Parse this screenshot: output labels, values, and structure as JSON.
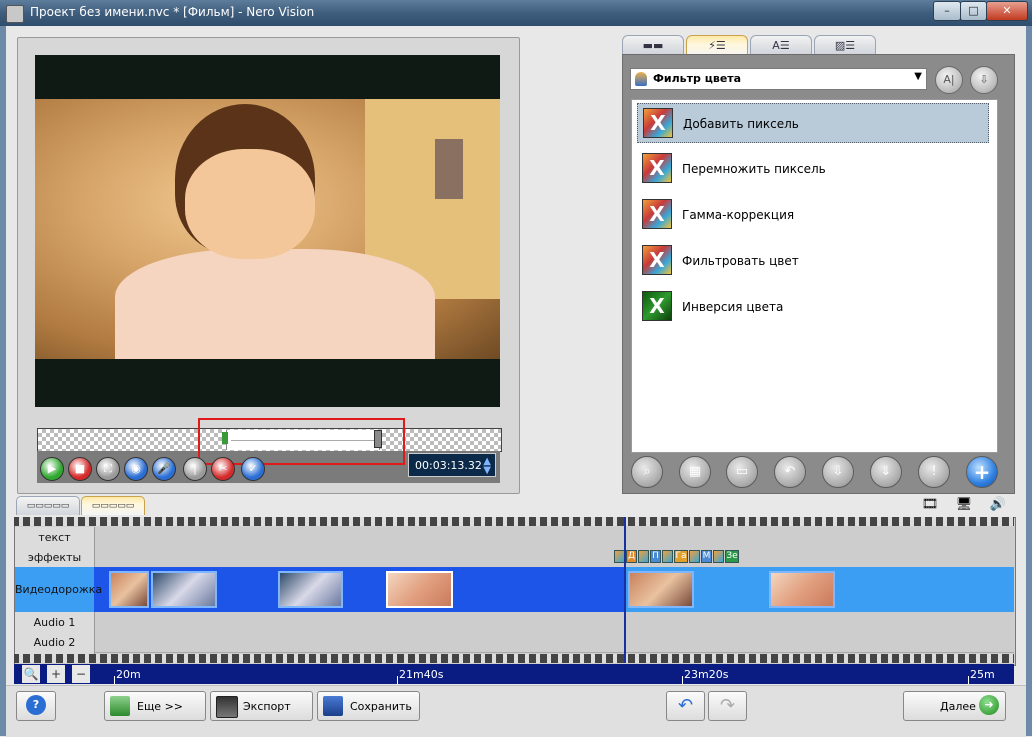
{
  "window": {
    "title": "Проект без имени.nvc * [Фильм] - Nero Vision",
    "min_glyph": "–",
    "max_glyph": "□",
    "close_glyph": "✕"
  },
  "preview": {
    "timecode": "00:03:13.32",
    "spin_up": "▲",
    "spin_down": "▼",
    "controls": [
      {
        "icon": "play-icon",
        "glyph": "▶",
        "color": "#2fa82f"
      },
      {
        "icon": "stop-icon",
        "glyph": "■",
        "color": "#d42a2a"
      },
      {
        "icon": "fullscreen-icon",
        "glyph": "⛶",
        "color": "#9a9a9a"
      },
      {
        "icon": "snapshot-icon",
        "glyph": "◉",
        "color": "#2a6ed4"
      },
      {
        "icon": "mic-icon",
        "glyph": "🎤",
        "color": "#2a6ed4"
      },
      {
        "icon": "split-icon",
        "glyph": "|",
        "color": "#9a9a9a"
      },
      {
        "icon": "cut-icon",
        "glyph": "✂",
        "color": "#d42a2a"
      },
      {
        "icon": "apply-icon",
        "glyph": "✓",
        "color": "#2a6ed4"
      }
    ]
  },
  "right_panel": {
    "tabs": [
      {
        "icon": "video-tab-icon",
        "glyph": "▬▬"
      },
      {
        "icon": "effects-tab-icon",
        "glyph": "⚡☰"
      },
      {
        "icon": "text-tab-icon",
        "glyph": "A☰"
      },
      {
        "icon": "transitions-tab-icon",
        "glyph": "▨☰"
      }
    ],
    "filter_select": "Фильтр цвета",
    "select_arrow": "▼",
    "top_buttons": [
      {
        "icon": "text-info-icon",
        "glyph": "A|"
      },
      {
        "icon": "download-icon",
        "glyph": "⇩"
      }
    ],
    "effects": [
      {
        "label": "Добавить пиксель",
        "selected": true,
        "glyph": "X",
        "style": "color"
      },
      {
        "label": "Перемножить пиксель",
        "selected": false,
        "glyph": "X",
        "style": "color"
      },
      {
        "label": "Гамма-коррекция",
        "selected": false,
        "glyph": "X",
        "style": "color"
      },
      {
        "label": "Фильтровать цвет",
        "selected": false,
        "glyph": "X",
        "style": "color"
      },
      {
        "label": "Инверсия цвета",
        "selected": false,
        "glyph": "X",
        "style": "green"
      }
    ],
    "bottom_buttons": [
      {
        "icon": "preview-search-icon",
        "glyph": "⌕"
      },
      {
        "icon": "film-properties-icon",
        "glyph": "▦"
      },
      {
        "icon": "delete-icon",
        "glyph": "▭"
      },
      {
        "icon": "undo-icon",
        "glyph": "↶"
      },
      {
        "icon": "move-down-icon",
        "glyph": "⇩"
      },
      {
        "icon": "move-bottom-icon",
        "glyph": "⇓"
      },
      {
        "icon": "warning-icon",
        "glyph": "!"
      },
      {
        "icon": "add-effect-icon",
        "glyph": "+"
      }
    ]
  },
  "view_tabs": [
    {
      "icon": "storyboard-tab-icon",
      "glyph": "▭▭▭▭▭"
    },
    {
      "icon": "timeline-tab-icon",
      "glyph": "▭▭▭▭▭"
    }
  ],
  "timeline": {
    "tracks": [
      "текст",
      "эффекты",
      "Видеодорожка",
      "Audio 1",
      "Audio 2"
    ],
    "effect_chips": [
      "Д",
      "П",
      "Га",
      "М",
      "Зе"
    ],
    "ruler": [
      "20m",
      "21m40s",
      "23m20s",
      "25m"
    ],
    "zoom_glyphs": [
      "🔍",
      "+",
      "−"
    ],
    "right_icons": [
      {
        "icon": "filmstrip-icon",
        "glyph": "🎞"
      },
      {
        "icon": "monitor-icon",
        "glyph": "🖥"
      },
      {
        "icon": "speaker-icon",
        "glyph": "🔊"
      }
    ]
  },
  "bottombar": {
    "help": "?",
    "more": "Еще >>",
    "export": "Экспорт",
    "save": "Сохранить",
    "undo_glyph": "↶",
    "redo_glyph": "↷",
    "next": "Далее",
    "next_glyph": "➜"
  }
}
